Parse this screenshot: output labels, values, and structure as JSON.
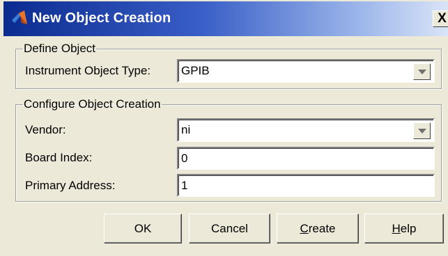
{
  "window": {
    "title": "New Object Creation",
    "close_glyph": "X",
    "icon": "matlab-logo-icon"
  },
  "define_object": {
    "legend": "Define Object",
    "instrument_type_label": "Instrument Object Type:",
    "instrument_type_value": "GPIB"
  },
  "configure": {
    "legend": "Configure Object Creation",
    "vendor_label": "Vendor:",
    "vendor_value": "ni",
    "board_index_label": "Board Index:",
    "board_index_value": "0",
    "primary_address_label": "Primary Address:",
    "primary_address_value": "1"
  },
  "buttons": {
    "ok": "OK",
    "cancel": "Cancel",
    "create_underlined": "C",
    "create_rest": "reate",
    "help_underlined": "H",
    "help_rest": "elp"
  }
}
